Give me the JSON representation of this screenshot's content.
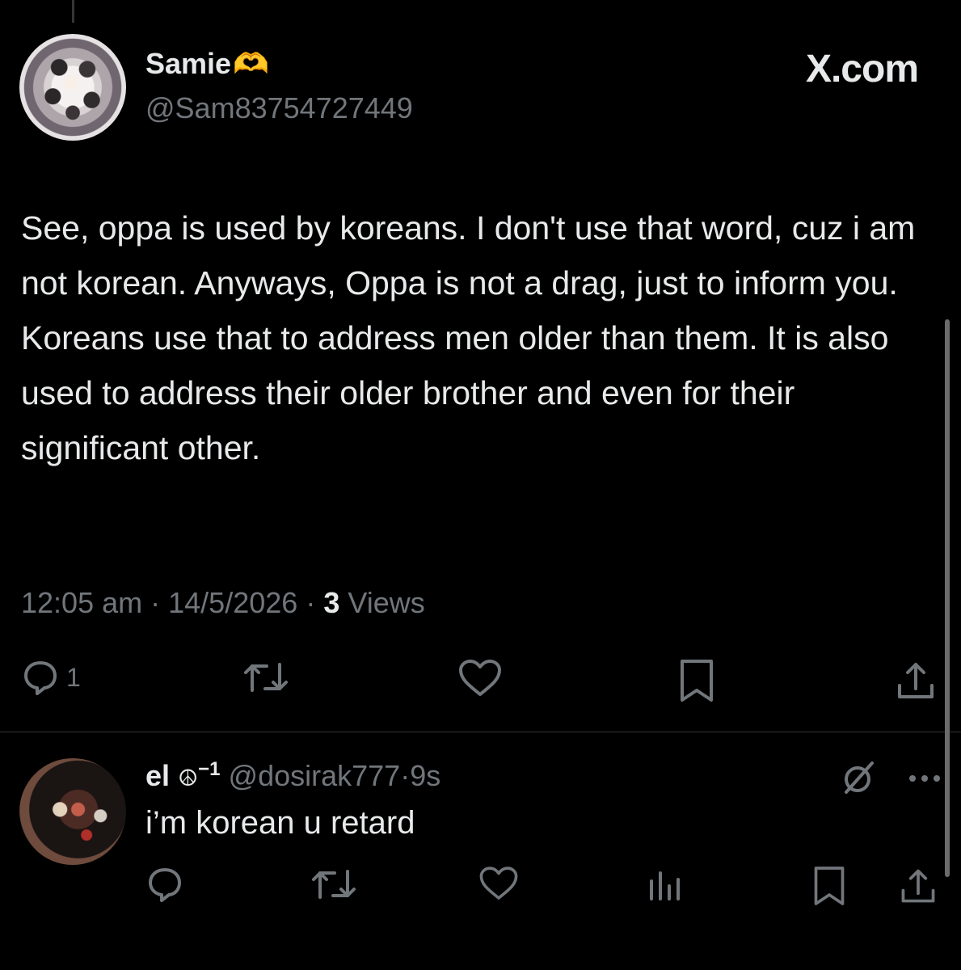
{
  "post": {
    "display_name": "Samie",
    "display_name_emoji": "🫶",
    "handle": "@Sam83754727449",
    "brand": "X.com",
    "text": "See, oppa is used by koreans. I don't use that word, cuz i am not korean. Anyways, Oppa is not a drag, just to inform you. Koreans use that to address men older than them. It is also used to address their older brother and even for their significant other.",
    "time": "12:05 am",
    "date": "14/5/2026",
    "views_count": "3",
    "views_label": "Views",
    "reply_count": "1"
  },
  "reply": {
    "name": "el",
    "name_symbol": "☮",
    "name_superscript": "−1",
    "handle": "@dosirak777",
    "time": "9s",
    "text": "i’m korean u retard"
  },
  "ui": {
    "separator": "·",
    "icons": {
      "reply": "reply-icon",
      "repost": "repost-icon",
      "like": "like-icon",
      "bookmark": "bookmark-icon",
      "share": "share-icon",
      "analytics": "analytics-icon",
      "grok": "grok-icon",
      "more": "more-icon"
    },
    "colors": {
      "background": "#000000",
      "text": "#e7e9ea",
      "muted": "#71767b"
    }
  }
}
